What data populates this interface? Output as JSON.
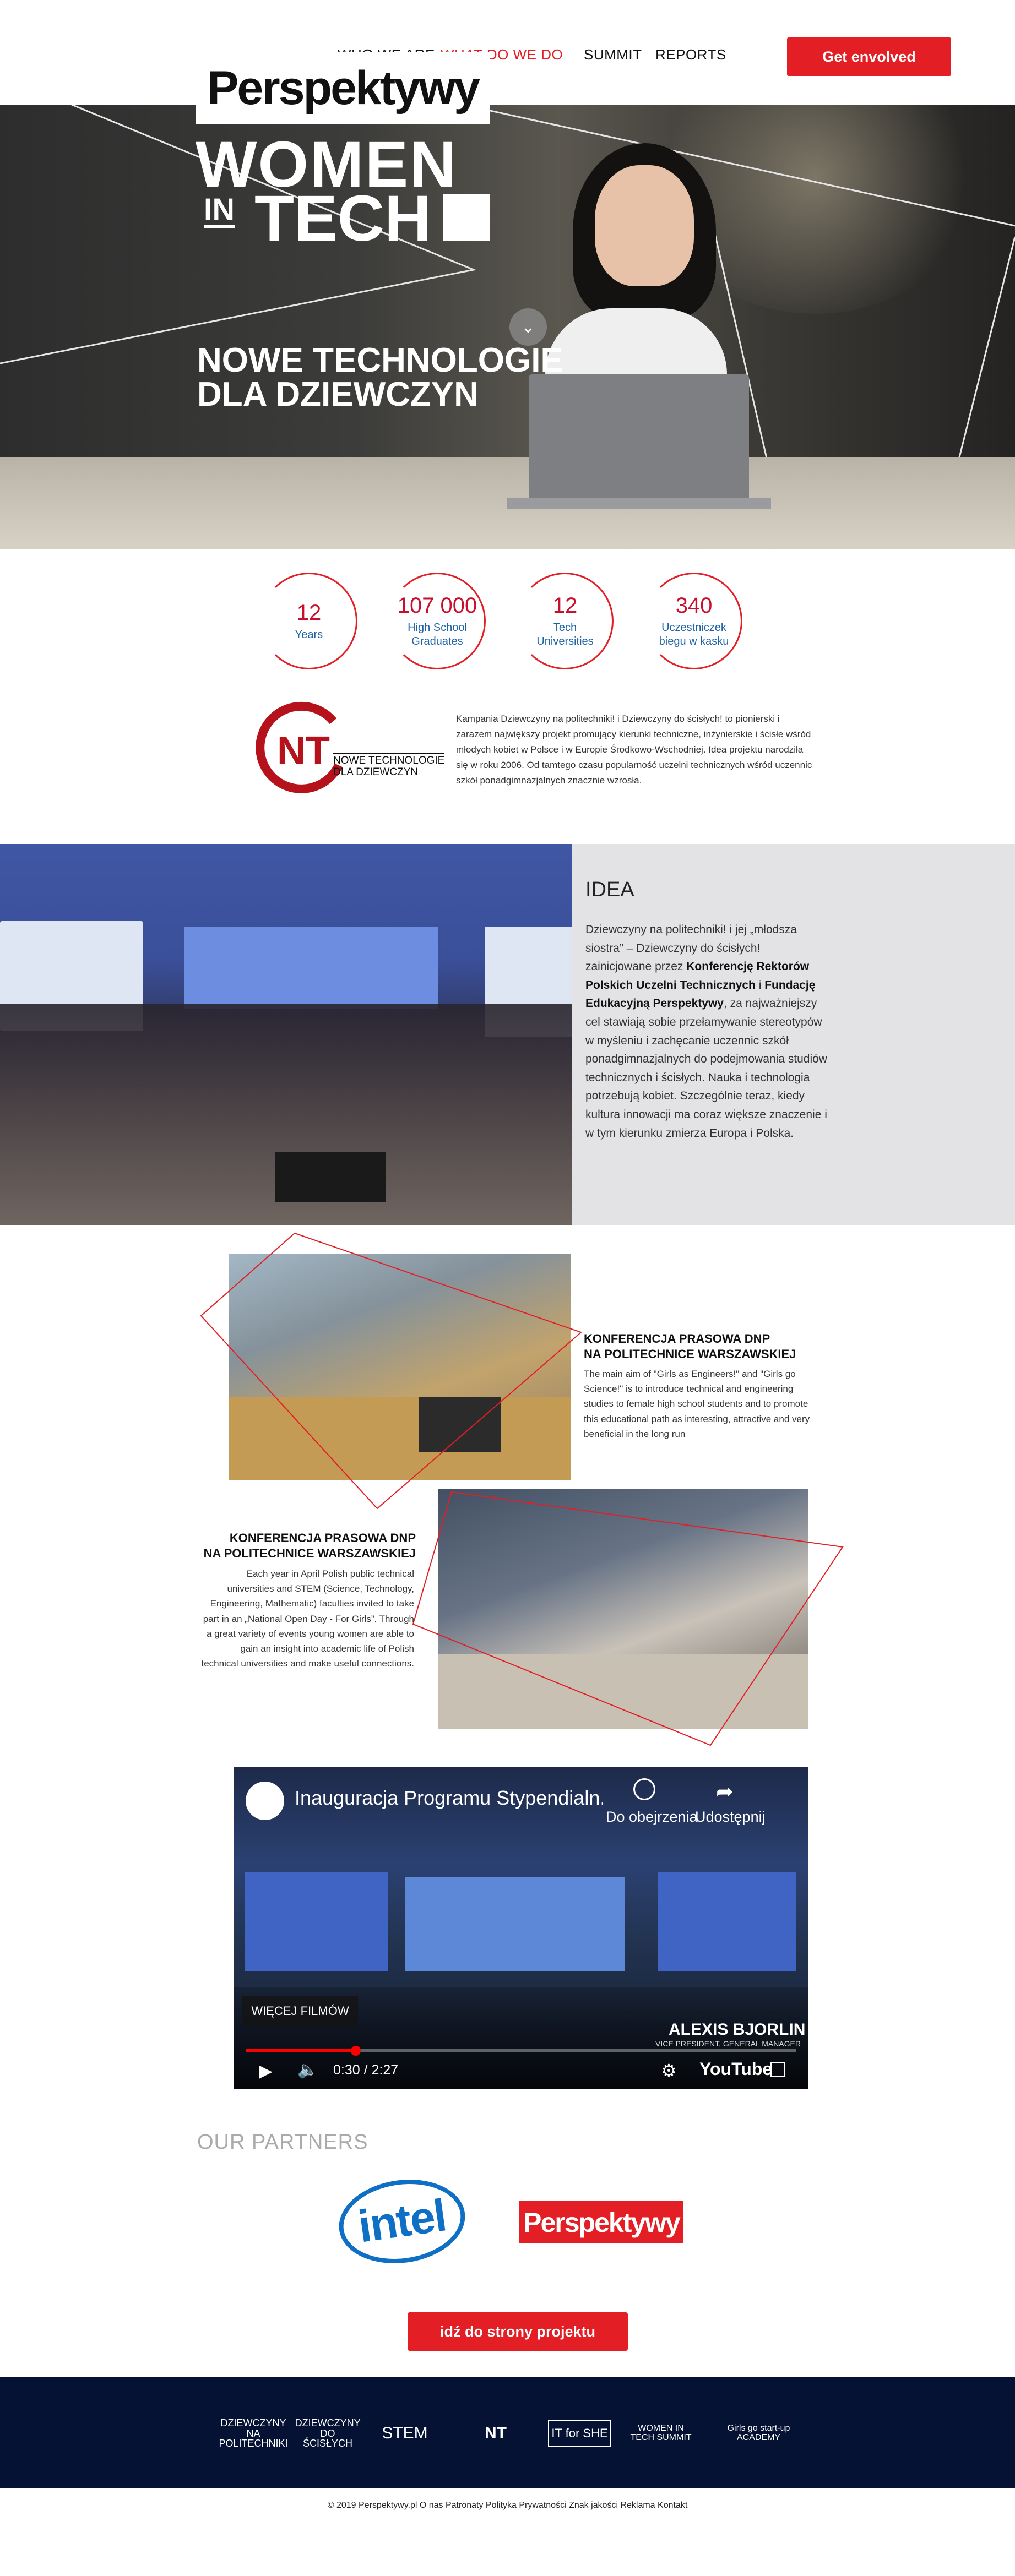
{
  "nav": {
    "items": [
      {
        "label": "WHO WE ARE",
        "active": false
      },
      {
        "label": "WHAT DO WE DO",
        "active": true
      },
      {
        "label": "SUMMIT",
        "active": false
      },
      {
        "label": "REPORTS",
        "active": false
      }
    ],
    "cta_label": "Get envolved"
  },
  "hero": {
    "logo_brand": "Perspektywy",
    "logo_women": "WOMEN",
    "logo_in": "IN",
    "logo_tech": "TECH",
    "title_line1": "NOWE TECHNOLOGIE",
    "title_line2": "DLA DZIEWCZYN",
    "scroll_icon": "chevron-down-icon"
  },
  "stats": [
    {
      "number": "12",
      "label_line1": "Years",
      "label_line2": ""
    },
    {
      "number": "107 000",
      "label_line1": "High School",
      "label_line2": "Graduates"
    },
    {
      "number": "12",
      "label_line1": "Tech",
      "label_line2": "Universities"
    },
    {
      "number": "340",
      "label_line1": "Uczestniczek",
      "label_line2": "biegu w kasku"
    }
  ],
  "nt": {
    "logo_letters": "NT",
    "logo_text_line1": "NOWE TECHNOLOGIE",
    "logo_text_line2": "DLA DZIEWCZYN",
    "description": "Kampania Dziewczyny na politechniki! i Dziewczyny do ścisłych! to pionierski i zarazem największy projekt promujący kierunki techniczne, inżynierskie i ścisłe wśród młodych kobiet w Polsce i w Europie Środkowo-Wschodniej. Idea projektu narodziła się w roku 2006. Od tamtego czasu popularność uczelni technicznych wśród uczennic szkół ponadgimnazjalnych znacznie wzrosła."
  },
  "idea": {
    "title": "IDEA",
    "text_part1": "Dziewczyny na politechniki! i jej „młodsza siostra” – Dziewczyny do ścisłych! zainicjowane przez ",
    "text_bold1": "Konferencję Rektorów Polskich Uczelni Technicznych",
    "text_part2": " i ",
    "text_bold2": "Fundację Edukacyjną Perspektywy",
    "text_part3": ", za najważniejszy cel stawiają sobie przełamywanie stereotypów w myśleniu i zachęcanie uczennic szkół ponadgimnazjalnych do podejmowania studiów technicznych i ścisłych. Nauka i technologia potrzebują kobiet. Szczególnie teraz, kiedy kultura innowacji ma coraz większe znaczenie i w tym kierunku zmierza Europa i Polska."
  },
  "conf1": {
    "title_line1": "KONFERENCJA PRASOWA DNP",
    "title_line2": "NA POLITECHNICE WARSZAWSKIEJ",
    "text": "The main aim of \"Girls as Engineers!\" and \"Girls go Science!\" is to introduce technical and engineering studies to female high school students and to promote this educational path as interesting, attractive and very beneficial in the long run"
  },
  "conf2": {
    "title_line1": "KONFERENCJA PRASOWA DNP",
    "title_line2": "NA POLITECHNICE WARSZAWSKIEJ",
    "text": "Each year in April Polish public technical universities and STEM (Science, Technology, Engineering, Mathematic) faculties invited to take part in an „National Open Day - For Girls”. Through a great variety of events young women are able to gain an insight into academic life of Polish technical universities and make useful connections."
  },
  "video": {
    "title": "Inauguracja Programu Stypendialn...",
    "watch_later": "Do obejrzenia",
    "share": "Udostępnij",
    "more_films": "WIĘCEJ FILMÓW",
    "time": "0:30 / 2:27",
    "progress_fraction": 0.2,
    "speaker_name": "ALEXIS BJORLIN",
    "speaker_role": "VICE PRESIDENT, GENERAL MANAGER",
    "youtube_label": "YouTube"
  },
  "partners": {
    "title": "OUR PARTNERS",
    "intel_label": "intel",
    "perspektywy_label": "Perspektywy"
  },
  "project_button": "idź do strony projektu",
  "footer": {
    "logos": [
      {
        "name": "dziewczyny-na-politechniki-logo",
        "label": "DZIEWCZYNY NA POLITECHNIKI"
      },
      {
        "name": "dziewczyny-do-scislych-logo",
        "label": "DZIEWCZYNY DO ŚCISŁYCH"
      },
      {
        "name": "lead-stem-logo",
        "label": "STEM"
      },
      {
        "name": "nowe-technologie-logo",
        "label": "NT"
      },
      {
        "name": "it-for-she-logo",
        "label": "IT for SHE"
      },
      {
        "name": "women-in-tech-summit-logo",
        "label": "WOMEN IN TECH SUMMIT"
      },
      {
        "name": "girls-go-start-up-logo",
        "label": "Girls go start-up ACADEMY"
      }
    ],
    "copyright": "© 2019 Perspektywy.pl O nas Patronaty Polityka Prywatności Znak jakości Reklama Kontakt"
  },
  "colors": {
    "accent_red": "#e31e25",
    "stat_number": "#c8102e",
    "stat_label": "#1e63a6",
    "footer_bg": "#061233",
    "idea_panel_bg": "#e3e3e6"
  }
}
